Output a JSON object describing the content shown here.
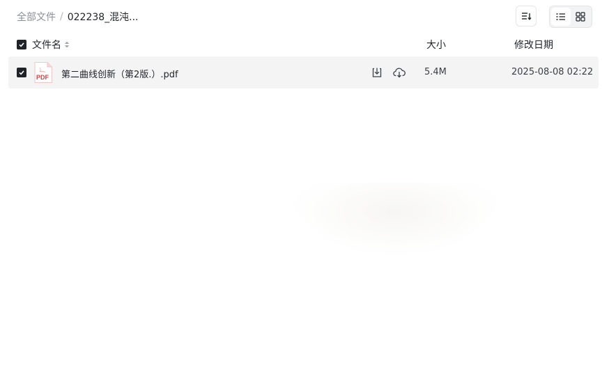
{
  "breadcrumb": {
    "root": "全部文件",
    "separator": "/",
    "current": "022238_混沌..."
  },
  "toolbar": {
    "sort_icon": "sort-icon",
    "view_list_icon": "list-view-icon",
    "view_grid_icon": "grid-view-icon",
    "active_view": "list"
  },
  "table": {
    "columns": {
      "name": "文件名",
      "size": "大小",
      "date": "修改日期"
    },
    "header_checked": true,
    "rows": [
      {
        "checked": true,
        "icon": "pdf-file-icon",
        "icon_label": "PDF",
        "name": "第二曲线创新（第2版.）.pdf",
        "size": "5.4M",
        "modified": "2025-08-08 02:22"
      }
    ]
  },
  "colors": {
    "row_bg": "#f4f4f5",
    "pdf_red": "#e23b3b",
    "text_primary": "#1f2329",
    "text_muted": "#8a8f99"
  }
}
